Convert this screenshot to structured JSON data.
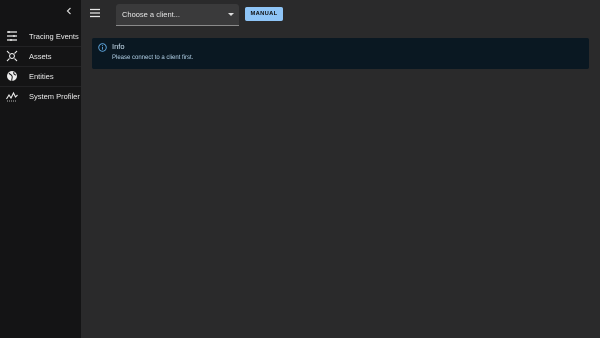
{
  "sidebar": {
    "items": [
      {
        "label": "Tracing Events",
        "icon": "tracing-events-icon"
      },
      {
        "label": "Assets",
        "icon": "assets-icon"
      },
      {
        "label": "Entities",
        "icon": "globe-icon"
      },
      {
        "label": "System Profiler",
        "icon": "profiler-icon"
      }
    ]
  },
  "toolbar": {
    "client_select_value": "Choose a client...",
    "manual_label": "MANUAL"
  },
  "alert": {
    "title": "Info",
    "message": "Please connect to a client first."
  },
  "colors": {
    "background": "#2a2a2b",
    "sidebar": "#141415",
    "accent": "#8ec4f6",
    "alert_bg": "#0a1822"
  }
}
